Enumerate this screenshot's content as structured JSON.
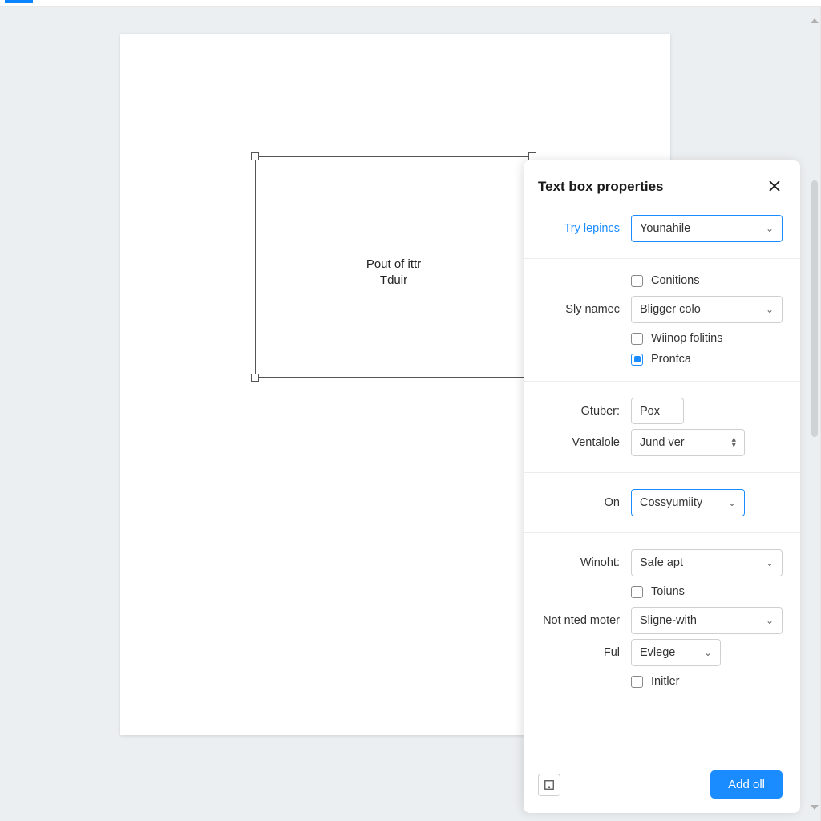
{
  "canvas": {
    "textbox_line1": "Pout of ittr",
    "textbox_line2": "Tduir"
  },
  "panel": {
    "title": "Text box properties",
    "row_try": {
      "label": "Try lepincs",
      "value": "Younahile"
    },
    "check_conitions": "Conitions",
    "row_style": {
      "label": "Sly namec",
      "value": "Bligger colo"
    },
    "check_wiinop": "Wiinop folitins",
    "check_pronfca": "Pronfca",
    "row_gtuber": {
      "label": "Gtuber:",
      "value": "Pox"
    },
    "row_ventalole": {
      "label": "Ventalole",
      "value": "Jund ver"
    },
    "row_on": {
      "label": "On",
      "value": "Cossyumiity"
    },
    "row_winoht": {
      "label": "Winoht:",
      "value": "Safe apt"
    },
    "check_toiuns": "Toiuns",
    "row_notnted": {
      "label": "Not nted moter",
      "value": "Sligne-with"
    },
    "row_ful": {
      "label": "Ful",
      "value": "Evlege"
    },
    "check_initler": "Initler",
    "primary_button": "Add oll"
  }
}
